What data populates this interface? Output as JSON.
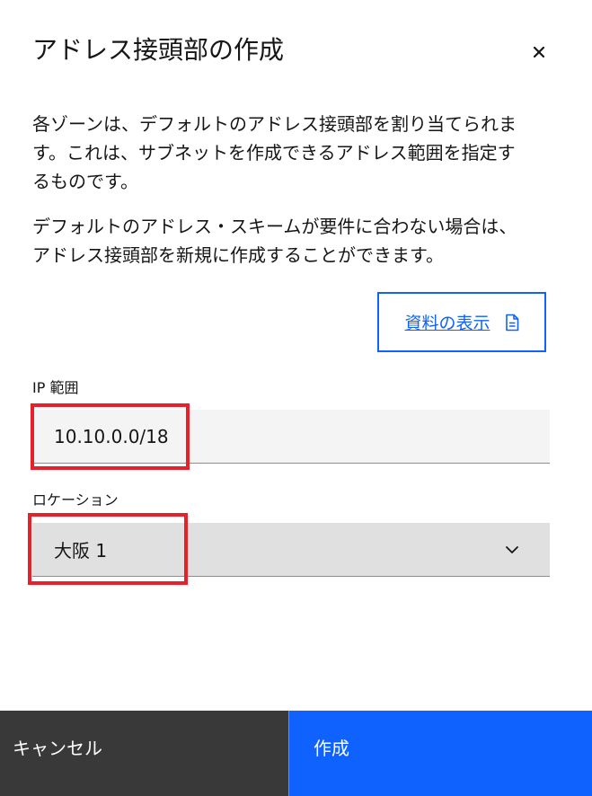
{
  "modal": {
    "title": "アドレス接頭部の作成",
    "close_icon": "close-icon"
  },
  "description": {
    "paragraph1_line1": "各ゾーンは、デフォルトのアドレス接頭部を割り当てられま",
    "paragraph1_line2": "す。これは、サブネットを作成できるアドレス範囲を指定す",
    "paragraph1_line3": "るものです。",
    "paragraph2_line1": "デフォルトのアドレス・スキームが要件に合わない場合は、",
    "paragraph2_line2": "アドレス接頭部を新規に作成することができます。"
  },
  "doc_link": {
    "label": "資料の表示",
    "icon": "document-icon"
  },
  "ip_range": {
    "label": "IP 範囲",
    "value": "10.10.0.0/18"
  },
  "location": {
    "label": "ロケーション",
    "selected": "大阪 1",
    "icon": "chevron-down-icon"
  },
  "footer": {
    "cancel_label": "キャンセル",
    "create_label": "作成"
  },
  "colors": {
    "primary": "#0f62fe",
    "secondary_button": "#393939",
    "highlight": "#e8202a",
    "input_bg": "#f4f4f4",
    "select_bg": "#e0e0e0"
  }
}
